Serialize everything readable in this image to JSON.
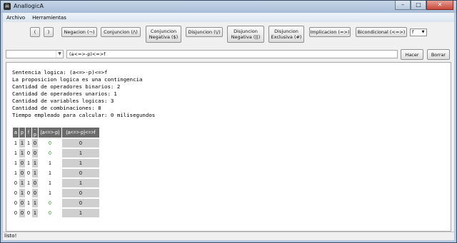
{
  "window": {
    "title": "AnallogicA",
    "minimize": "–",
    "maximize": "□",
    "close": "✕",
    "icon": "skull-icon"
  },
  "menu": [
    "Archivo",
    "Herramientas"
  ],
  "toolbar": {
    "open_paren": "(",
    "close_paren": ")",
    "negacion": "Negacion (¬)",
    "conjuncion": "Conjuncion (/\\)",
    "conjuncion_negativa": "Conjuncion\nNegativa ($)",
    "disjuncion": "Disjuncion (\\/)",
    "disjuncion_negativa": "Disjuncion\nNegativa (||)",
    "disjuncion_exclusiva": "Disjuncion\nExclusiva (#)",
    "implicacion": "Implicacion (=>)",
    "bicondicional": "Bicondicional (<=>)",
    "variable_select": "f"
  },
  "input": {
    "history_select": "",
    "expression": "(a<=>-p)<=>f",
    "hacer": "Hacer",
    "borrar": "Borrar"
  },
  "output": {
    "lines": [
      "Sentencia logica: (a<=>-p)<=>f",
      "La proposicion logica es una contingencia",
      "Cantidad de operadores binarios: 2",
      "Cantidad de operadores unarios: 1",
      "Cantidad de variables logicas: 3",
      "Cantidad de combinaciones: 8",
      "Tiempo empleado para calcular: 0 milisegundos"
    ],
    "table": {
      "headers": [
        "a",
        "p",
        "f",
        "-p",
        "(a<=>-p)",
        "(a<=>-p)<=>f"
      ],
      "rows": [
        [
          "1",
          "1",
          "1",
          "0",
          "0",
          "0"
        ],
        [
          "1",
          "1",
          "0",
          "0",
          "0",
          "1"
        ],
        [
          "1",
          "0",
          "1",
          "1",
          "1",
          "1"
        ],
        [
          "1",
          "0",
          "0",
          "1",
          "1",
          "0"
        ],
        [
          "0",
          "1",
          "1",
          "0",
          "1",
          "1"
        ],
        [
          "0",
          "1",
          "0",
          "0",
          "1",
          "0"
        ],
        [
          "0",
          "0",
          "1",
          "1",
          "0",
          "0"
        ],
        [
          "0",
          "0",
          "0",
          "1",
          "0",
          "1"
        ]
      ]
    }
  },
  "status": "listo!"
}
